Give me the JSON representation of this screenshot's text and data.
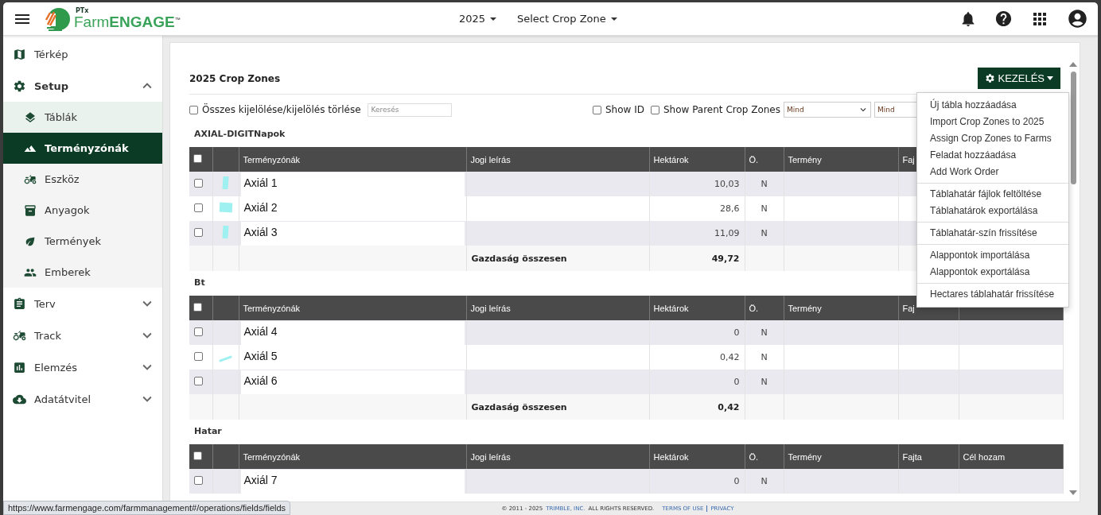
{
  "header": {
    "logo": {
      "top": "PTx",
      "brand": "Farm**ENGAGE**$^{™}$"
    },
    "pickers": [
      {
        "label": "2025"
      },
      {
        "label": "Select Crop Zone"
      }
    ]
  },
  "sidebar": {
    "items": [
      {
        "label": "Térkép",
        "selected": false
      },
      {
        "label": "Setup",
        "selected": false,
        "expanded": true,
        "children": [
          {
            "label": "Táblák",
            "selected": false
          },
          {
            "label": "Terményzónák",
            "selected": true
          },
          {
            "label": "Eszköz",
            "selected": false
          },
          {
            "label": "Anyagok",
            "selected": false
          },
          {
            "label": "Termények",
            "selected": false
          },
          {
            "label": "Emberek",
            "selected": false
          }
        ]
      },
      {
        "label": "Terv",
        "selected": false,
        "expanded": false
      },
      {
        "label": "Track",
        "selected": false,
        "expanded": false
      },
      {
        "label": "Elemzés",
        "selected": false,
        "expanded": false
      },
      {
        "label": "Adatátvitel",
        "selected": false,
        "expanded": false
      }
    ]
  },
  "page": {
    "title": "2025 Crop Zones",
    "manage_button": "KEZELÉS",
    "toolbar": {
      "select_all": {
        "label": "Összes kijelölése/kijelölés törlése",
        "checked": false
      },
      "search": {
        "placeholder": "Keresés"
      },
      "show_id": {
        "label": "Show ID",
        "checked": false
      },
      "show_parent": {
        "label": "Show Parent Crop Zones",
        "checked": false
      },
      "filters": [
        {
          "value": "Mind"
        },
        {
          "value": "Mind"
        }
      ]
    },
    "groups": [
      {
        "name": "AXIAL-DIGITNapok",
        "columns": [
          "Terményzónák",
          "Jogi leírás",
          "Hektárok",
          "Ö.",
          "Termény",
          "Faj"
        ],
        "header_checked": false,
        "rows": [
          {
            "checked": false,
            "kind": "tall",
            "name": "Axiál 1",
            "hectares": "10,03",
            "o": "N"
          },
          {
            "checked": false,
            "kind": "wide",
            "name": "Axiál 2",
            "hectares": "28,6",
            "o": "N"
          },
          {
            "checked": false,
            "kind": "tall",
            "name": "Axiál 3",
            "hectares": "11,09",
            "o": "N"
          }
        ],
        "total_label": "Gazdaság összesen",
        "total": "49,72"
      },
      {
        "name": "Bt",
        "columns": [
          "Terményzónák",
          "Jogi leírás",
          "Hektárok",
          "Ö.",
          "Termény",
          "Faj"
        ],
        "header_checked": false,
        "rows": [
          {
            "checked": false,
            "kind": "plain",
            "name": "Axiál 4",
            "hectares": "0",
            "o": "N"
          },
          {
            "checked": false,
            "kind": "stroke",
            "name": "Axiál 5",
            "hectares": "0,42",
            "o": "N"
          },
          {
            "checked": false,
            "kind": "plain",
            "name": "Axiál 6",
            "hectares": "0",
            "o": "N"
          }
        ],
        "total_label": "Gazdaság összesen",
        "total": "0,42"
      },
      {
        "name": "Hatar",
        "columns": [
          "Terményzónák",
          "Jogi leírás",
          "Hektárok",
          "Ö.",
          "Termény",
          "Fajta",
          "Cél hozam"
        ],
        "header_checked": false,
        "rows": [
          {
            "checked": false,
            "kind": "plain",
            "name": "Axiál 7",
            "hectares": "0",
            "o": "N"
          }
        ]
      }
    ],
    "menu": [
      [
        "Új tábla hozzáadása",
        "Import Crop Zones to 2025",
        "Assign Crop Zones to Farms",
        "Feladat hozzáadása",
        "Add Work Order"
      ],
      [
        "Táblahatár fájlok feltöltése",
        "Táblahatárok exportálása"
      ],
      [
        "Táblahatár-szín frissítése"
      ],
      [
        "Alappontok importálása",
        "Alappontok exportálása"
      ],
      [
        "Hectares táblahatár frissítése"
      ]
    ]
  },
  "footer": {
    "copyright": "© 2011 - 2025",
    "company": "TRIMBLE, INC.",
    "rights": "ALL RIGHTS RESERVED.",
    "links": [
      "TERMS OF USE",
      "PRIVACY"
    ]
  },
  "status_url": "https://www.farmengage.com/farmmanagement#/operations/fields/fields"
}
